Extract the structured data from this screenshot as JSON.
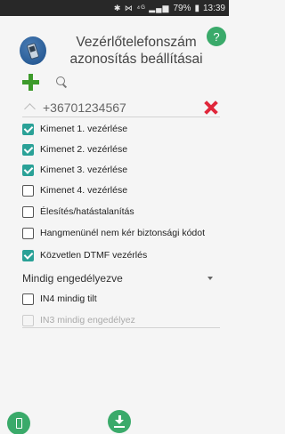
{
  "status_bar": {
    "icons": "✱ ⋈ ⁴ᴳ ▂▄▆",
    "battery": "79%",
    "battery_icon": "▮",
    "time": "13:39"
  },
  "header": {
    "app_icon": "phone-icon",
    "title_line1": "Vezérlőtelefonszám",
    "title_line2": "azonosítás beállításai",
    "help_label": "?"
  },
  "toolbar": {
    "add_icon": "plus-icon",
    "search_icon": "search-icon"
  },
  "phone": {
    "number": "+36701234567",
    "delete_icon": "close-icon"
  },
  "options": [
    {
      "label": "Kimenet 1. vezérlése",
      "checked": true
    },
    {
      "label": "Kimenet 2. vezérlése",
      "checked": true
    },
    {
      "label": "Kimenet 3. vezérlése",
      "checked": true
    },
    {
      "label": "Kimenet 4. vezérlése",
      "checked": false
    },
    {
      "label": "Élesítés/hatástalanítás",
      "checked": false
    },
    {
      "label": "Hangmenünél nem kér biztonsági kódot",
      "checked": false
    },
    {
      "label": "Közvetlen DTMF vezérlés",
      "checked": true
    }
  ],
  "mode_select": {
    "value": "Mindig engedélyezve"
  },
  "extra_options": [
    {
      "label": "IN4 mindig tilt",
      "checked": false,
      "disabled": false
    },
    {
      "label": "IN3 mindig engedélyez",
      "checked": false,
      "disabled": true
    }
  ],
  "colors": {
    "accent": "#2aa197",
    "green": "#3aaa6a",
    "plus": "#3d9a2b",
    "delete": "#e0263a"
  }
}
